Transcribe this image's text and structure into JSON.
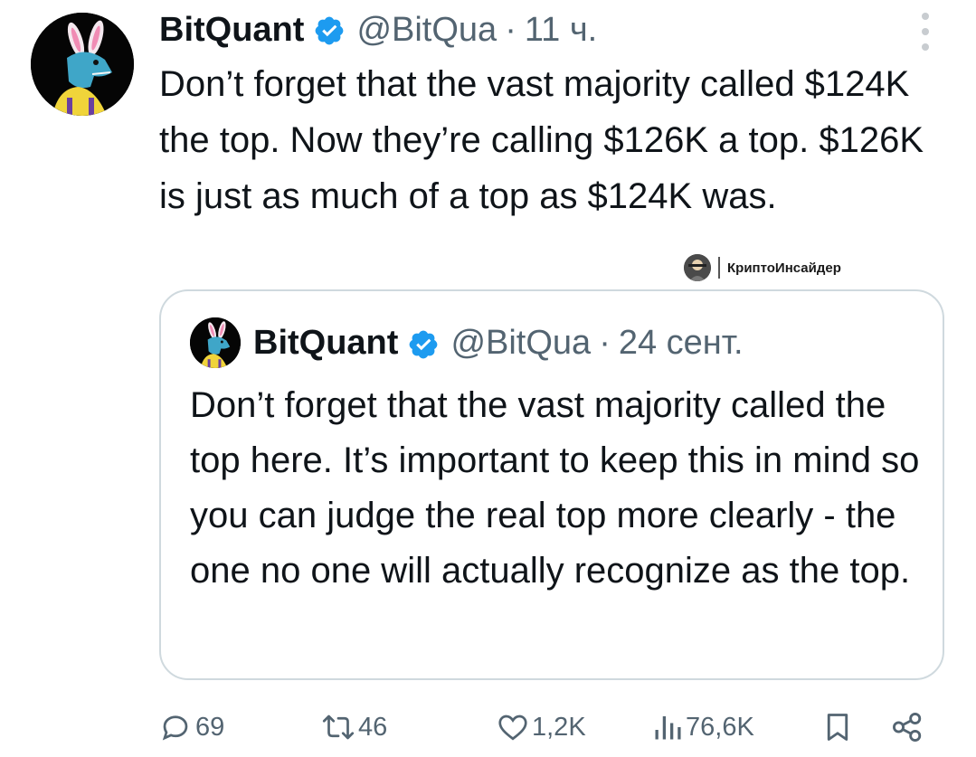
{
  "tweet": {
    "author_name": "BitQuant",
    "handle": "@BitQua",
    "separator": "·",
    "time": "11 ч.",
    "text": "Don’t forget that the vast majority called $124K the top. Now they’re calling $126K a top. $126K is just as much of a top as $124K was."
  },
  "watermark": {
    "label": "КриптоИнсайдер"
  },
  "quoted_tweet": {
    "author_name": "BitQuant",
    "handle": "@BitQua",
    "separator": "·",
    "time": "24 сент.",
    "text": "Don’t forget that the vast majority called the top here. It’s important to keep this in mind so you can judge the real top more clearly - the one no one will actually recognize as the top."
  },
  "actions": {
    "replies": "69",
    "reposts": "46",
    "likes": "1,2K",
    "views": "76,6K"
  },
  "colors": {
    "text": "#0f1419",
    "secondary": "#536471",
    "verified": "#1d9bf0",
    "border": "#cfd9de"
  },
  "icons": [
    "more-icon",
    "verified-icon",
    "reply-icon",
    "repost-icon",
    "like-icon",
    "views-icon",
    "bookmark-icon",
    "share-icon"
  ]
}
